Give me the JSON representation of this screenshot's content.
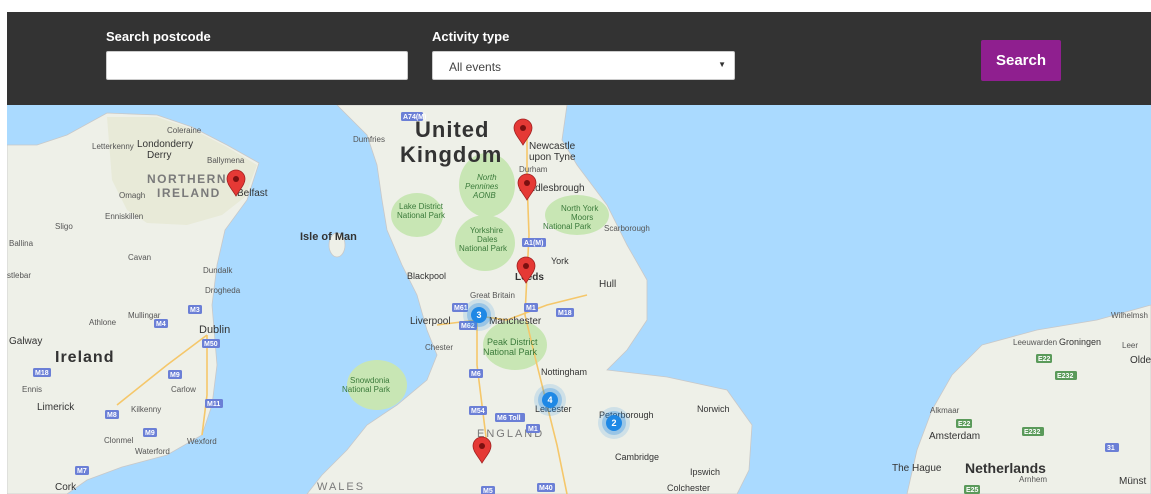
{
  "search_form": {
    "postcode_label": "Search postcode",
    "postcode_value": "",
    "activity_label": "Activity type",
    "activity_value": "All events",
    "search_button": "Search",
    "accent_color": "#8f1f8f",
    "bar_color": "#333333"
  },
  "map": {
    "labels": {
      "united": "United",
      "kingdom": "Kingdom",
      "northern": "NORTHERN",
      "ireland_ni": "IRELAND",
      "ireland": "Ireland",
      "isle_of_man": "Isle of Man",
      "england": "ENGLAND",
      "wales": "WALES",
      "netherlands": "Netherlands",
      "coleraine": "Coleraine",
      "letterkenny": "Letterkenny",
      "londonderry": "Londonderry",
      "derry": "Derry",
      "ballymena": "Ballymena",
      "omagh": "Omagh",
      "belfast": "Belfast",
      "enniskillen": "Enniskillen",
      "sligo": "Sligo",
      "ballina": "Ballina",
      "cavan": "Cavan",
      "dundalk": "Dundalk",
      "drogheda": "Drogheda",
      "castlebar": "stlebar",
      "mullingar": "Mullingar",
      "athlone": "Athlone",
      "dublin": "Dublin",
      "galway": "Galway",
      "ennis": "Ennis",
      "carlow": "Carlow",
      "limerick": "Limerick",
      "kilkenny": "Kilkenny",
      "clonmel": "Clonmel",
      "waterford": "Waterford",
      "wexford": "Wexford",
      "cork": "Cork",
      "dumfries": "Dumfries",
      "newcastle": "Newcastle",
      "upon_tyne": "upon Tyne",
      "durham": "Durham",
      "north_pennines": "North",
      "pennines": "Pennines",
      "aonb": "AONB",
      "middlesbrough": "Middlesbrough",
      "north_york": "North York",
      "moors": "Moors",
      "national_park": "National Park",
      "scarborough": "Scarborough",
      "lake_district": "Lake District",
      "lake_np": "National Park",
      "yorkshire": "Yorkshire",
      "dales": "Dales",
      "dales_np": "National Park",
      "york": "York",
      "leeds": "Leeds",
      "blackpool": "Blackpool",
      "great_britain": "Great Britain",
      "hull": "Hull",
      "liverpool": "Liverpool",
      "manchester": "Manchester",
      "chester": "Chester",
      "peak_district": "Peak District",
      "peak_np": "National Park",
      "nottingham": "Nottingham",
      "snowdonia": "Snowdonia",
      "snowdonia_np": "National Park",
      "leicester": "Leicester",
      "peterborough": "Peterborough",
      "norwich": "Norwich",
      "cambridge": "Cambridge",
      "ipswich": "Ipswich",
      "colchester": "Colchester",
      "alkmaar": "Alkmaar",
      "amsterdam": "Amsterdam",
      "the_hague": "The Hague",
      "arnhem": "Arnhem",
      "leeuwarden": "Leeuwarden",
      "groningen": "Groningen",
      "wilhelmshaven": "Wilhelmsh",
      "leer": "Leer",
      "olde": "Olde",
      "munster": "Münst"
    },
    "road_shields": {
      "a74m": "A74(M)",
      "a1m": "A1(M)",
      "m1_north": "M1",
      "m18": "M18",
      "m61": "M61",
      "m62": "M62",
      "m6": "M6",
      "m54": "M54",
      "m6_toll": "M6 Toll",
      "m1": "M1",
      "m5": "M5",
      "m40": "M40",
      "m3_ie": "M3",
      "m4_ie": "M4",
      "m50": "M50",
      "m18_ie": "M18",
      "m9": "M9",
      "m11": "M11",
      "m8": "M8",
      "m9b": "M9",
      "m7": "M7",
      "e22": "E22",
      "e232": "E232",
      "e22b": "E22",
      "e232b": "E232",
      "n31": "31",
      "e25": "E25"
    },
    "clusters": [
      "3",
      "4",
      "2"
    ]
  }
}
